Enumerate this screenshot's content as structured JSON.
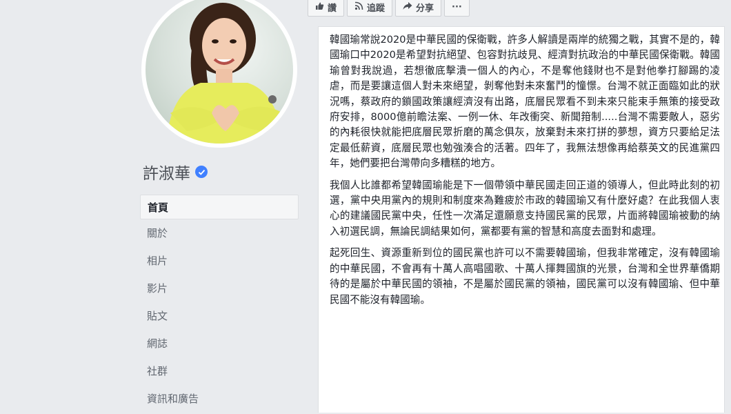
{
  "page": {
    "name": "許淑華",
    "verified_badge": "verified-check-icon"
  },
  "nav": {
    "items": [
      {
        "label": "首頁",
        "active": true
      },
      {
        "label": "關於"
      },
      {
        "label": "相片"
      },
      {
        "label": "影片"
      },
      {
        "label": "貼文"
      },
      {
        "label": "網誌"
      },
      {
        "label": "社群"
      },
      {
        "label": "資訊和廣告"
      }
    ]
  },
  "actions": {
    "like_label": "讚",
    "follow_label": "追蹤",
    "share_label": "分享",
    "more_label": "···"
  },
  "post": {
    "paragraphs": [
      "韓國瑜常說2020是中華民國的保衛戰，許多人解讀是兩岸的統獨之戰，其實不是的，韓國瑜口中2020是希望對抗絕望、包容對抗歧見、經濟對抗政治的中華民國保衛戰。韓國瑜曾對我說過，若想徹底擊潰一個人的內心，不是奪他錢財也不是對他拳打腳踢的凌虐，而是要讓這個人對未來絕望，剝奪他對未來奮鬥的憧憬。台灣不就正面臨如此的狀況嗎，蔡政府的鎖國政策讓經濟沒有出路，底層民眾看不到未來只能束手無策的接受政府安排，8000億前瞻法案、一例一休、年改衝突、新聞箝制.....台灣不需要敵人，惡劣的內耗很快就能把底層民眾折磨的萬念俱灰，放棄對未來打拼的夢想，資方只要給足法定最低薪資，底層民眾也勉強湊合的活著。四年了，我無法想像再給蔡英文的民進黨四年，她們要把台灣帶向多糟糕的地方。",
      "我個人比誰都希望韓國瑜能是下一個帶領中華民國走回正道的領導人，但此時此刻的初選，黨中央用黨內的規則和制度來為難疲於市政的韓國瑜又有什麼好處？在此我個人衷心的建議國民黨中央，任性一次滿足還願意支持國民黨的民眾，片面將韓國瑜被動的納入初選民調，無論民調結果如何，黨都要有黨的智慧和高度去面對和處理。",
      "起死回生、資源重新到位的國民黨也許可以不需要韓國瑜，但我非常確定，沒有韓國瑜的中華民國，不會再有十萬人高唱國歌、十萬人揮舞國旗的光景，台灣和全世界華僑期待的是屬於中華民國的領袖，不是屬於國民黨的領袖，國民黨可以沒有韓國瑜、但中華民國不能沒有韓國瑜。"
    ]
  },
  "colors": {
    "background": "#e9ebee",
    "verified": "#4080ff",
    "text": "#1d2129",
    "muted": "#616770"
  }
}
